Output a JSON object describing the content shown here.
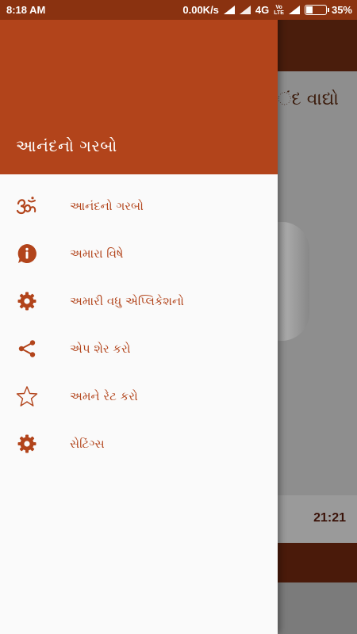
{
  "status_bar": {
    "time": "8:18 AM",
    "network_speed": "0.00K/s",
    "network_type": "4G",
    "volte_line1": "Vo",
    "volte_line2": "LTE",
    "battery_text": "35%",
    "battery_level": 0.35
  },
  "background_app": {
    "title_fragment": "ંદ વાદ્યો",
    "track_time": "21:21"
  },
  "drawer": {
    "header_title": "આનંદનો ગરબો",
    "items": [
      {
        "label": "આનંદનો ગરબો",
        "icon": "om-icon"
      },
      {
        "label": "અમારા વિષે",
        "icon": "info-icon"
      },
      {
        "label": "અમારી વધુ એપ્લિકેશનો",
        "icon": "gear-icon"
      },
      {
        "label": "એપ શેર કરો",
        "icon": "share-icon"
      },
      {
        "label": "અમને રેટ કરો",
        "icon": "star-icon"
      },
      {
        "label": "સેટિંગ્સ",
        "icon": "gear-icon"
      }
    ]
  },
  "colors": {
    "accent": "#b2441b",
    "status_bar": "#8a3210",
    "drawer_background": "#fafafa"
  }
}
